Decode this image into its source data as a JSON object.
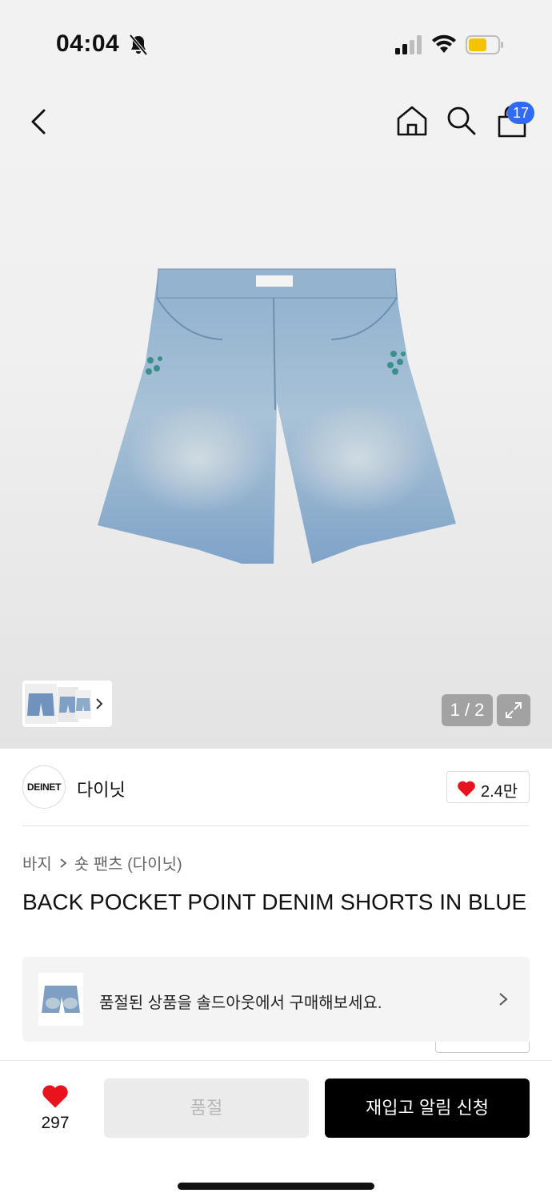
{
  "status": {
    "time": "04:04",
    "icons": [
      "bell-off-icon",
      "signal-icon",
      "wifi-icon",
      "battery-icon"
    ],
    "battery_color": "#f5c400"
  },
  "nav": {
    "back_icon": "chevron-left-icon",
    "home_icon": "home-icon",
    "search_icon": "search-icon",
    "cart_icon": "shopping-bag-icon",
    "cart_count": "17"
  },
  "gallery": {
    "page_indicator": "1 / 2",
    "expand_icon": "expand-icon"
  },
  "brand": {
    "logo_text": "DEINET",
    "name": "다이닛",
    "likes": "2.4만"
  },
  "breadcrumb": {
    "category": "바지",
    "subcategory": "숏 팬츠 (다이닛)"
  },
  "product": {
    "title": "BACK POCKET POINT DENIM SHORTS IN BLUE"
  },
  "soldout_banner": {
    "text": "품절된 상품을 솔드아웃에서 구매해보세요."
  },
  "bottom_bar": {
    "wish_count": "297",
    "soldout_label": "품절",
    "restock_label": "재입고 알림 신청"
  },
  "colors": {
    "accent": "#2f6bf5",
    "heart": "#e8131d",
    "primary_button": "#000000"
  }
}
